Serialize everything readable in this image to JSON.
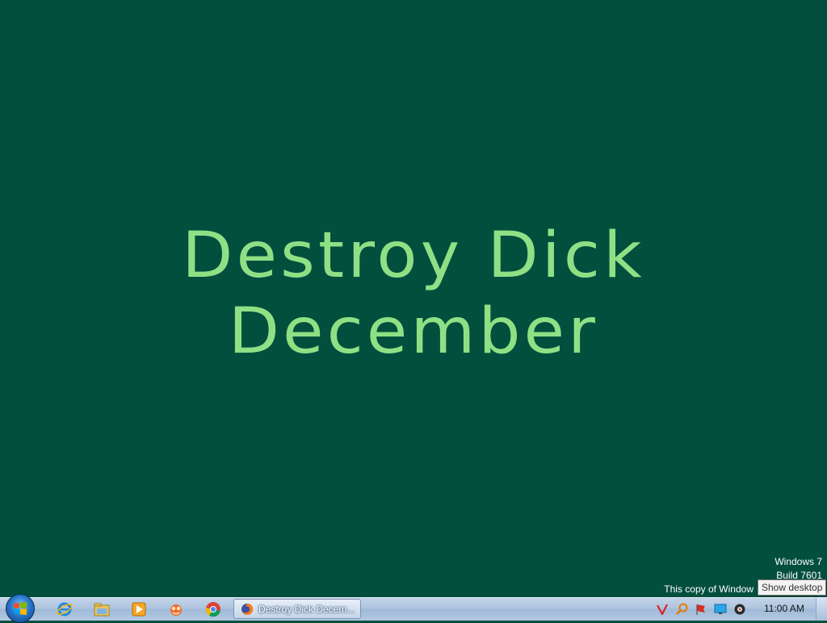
{
  "desktop": {
    "headline_line1": "Destroy Dick",
    "headline_line2": "December",
    "background_color": "#024f3d",
    "text_color": "#8fe085"
  },
  "watermark": {
    "line1": "Windows 7",
    "line2": "Build 7601",
    "line3": "This copy of Window"
  },
  "tooltip": {
    "text": "Show desktop"
  },
  "taskbar": {
    "start_icon": "windows-orb-icon",
    "pinned": [
      {
        "name": "internet-explorer-icon"
      },
      {
        "name": "file-explorer-icon"
      },
      {
        "name": "media-player-icon"
      },
      {
        "name": "app-icon"
      },
      {
        "name": "chrome-icon"
      }
    ],
    "active_task": {
      "icon": "firefox-icon",
      "label": "Destroy Dick Decem..."
    },
    "tray": [
      {
        "name": "vodafone-icon"
      },
      {
        "name": "search-tool-icon"
      },
      {
        "name": "action-center-flag-icon"
      },
      {
        "name": "network-icon"
      },
      {
        "name": "volume-icon"
      }
    ],
    "clock": "11:00 AM"
  }
}
